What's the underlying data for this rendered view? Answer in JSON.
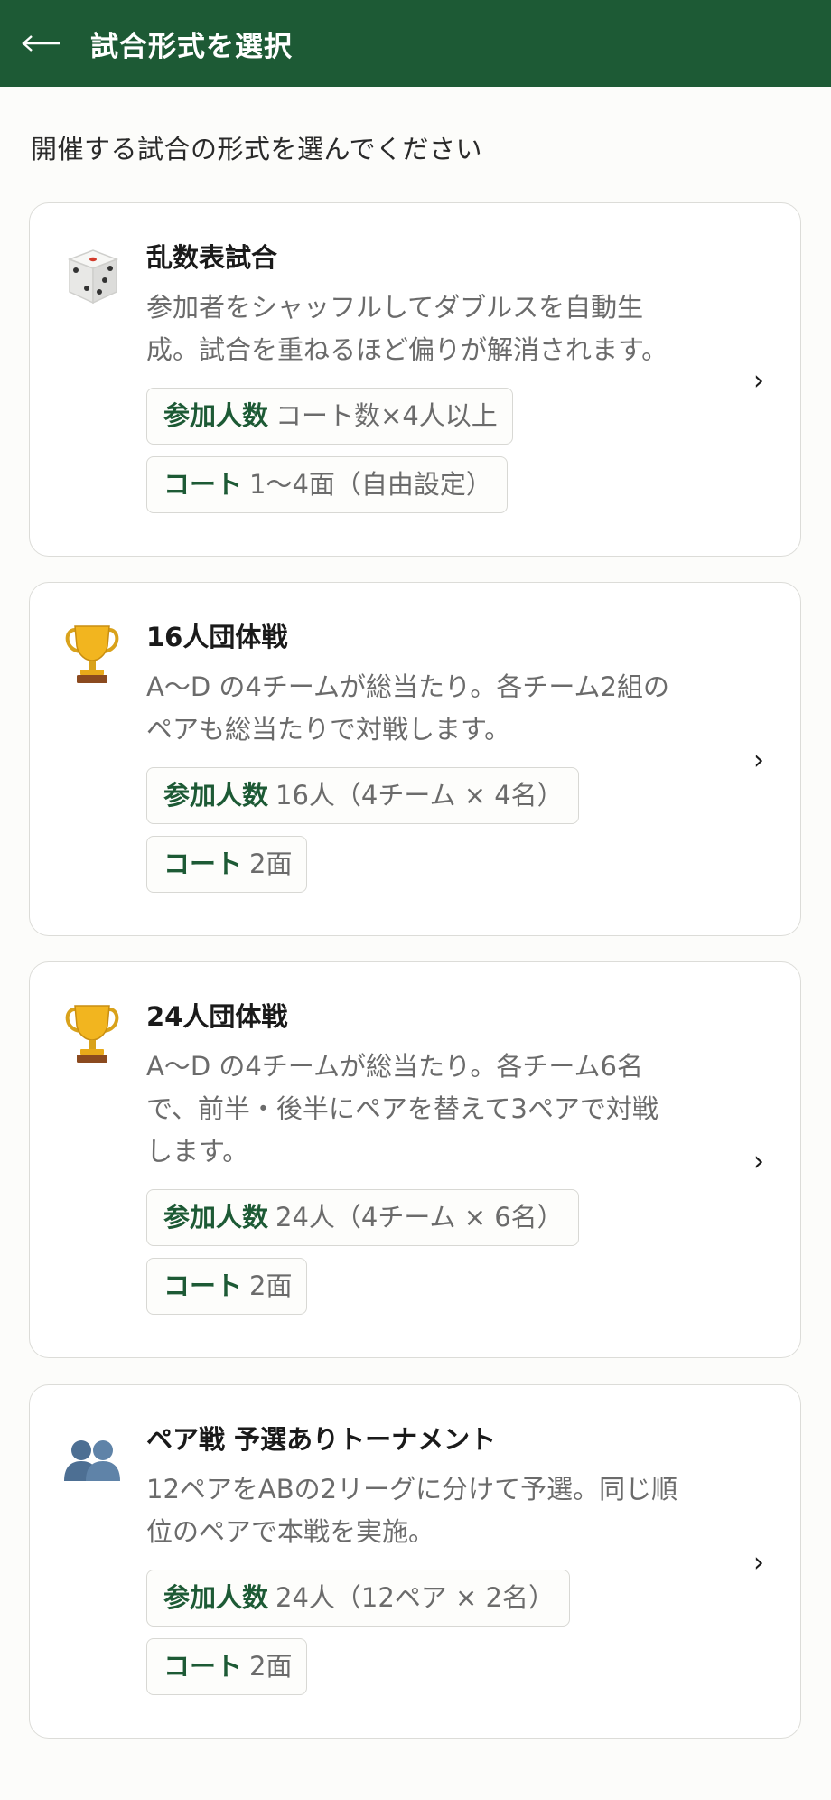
{
  "appbar": {
    "title": "試合形式を選択",
    "back_icon": "arrow-left-icon"
  },
  "intro": "開催する試合の形式を選んでください",
  "cards": [
    {
      "icon": "dice-icon",
      "title": "乱数表試合",
      "desc_lines": [
        "参加者をシャッフルしてダブルスを自動生",
        "成。試合を重ねるほど偏りが解消されます。"
      ],
      "players_key": "参加人数",
      "players_val": "コート数×4人以上",
      "courts_key": "コート",
      "courts_val": "1〜4面（自由設定）"
    },
    {
      "icon": "trophy-icon",
      "title": "16人団体戦",
      "desc_lines": [
        "A〜D の4チームが総当たり。各チーム2組の",
        "ペアも総当たりで対戦します。"
      ],
      "players_key": "参加人数",
      "players_val": "16人（4チーム × 4名）",
      "courts_key": "コート",
      "courts_val": "2面"
    },
    {
      "icon": "trophy-icon",
      "title": "24人団体戦",
      "desc_lines": [
        "A〜D の4チームが総当たり。各チーム6名",
        "で、前半・後半にペアを替えて3ペアで対戦",
        "します。"
      ],
      "players_key": "参加人数",
      "players_val": "24人（4チーム × 6名）",
      "courts_key": "コート",
      "courts_val": "2面"
    },
    {
      "icon": "two-people-icon",
      "title": "ペア戦 予選ありトーナメント",
      "desc_lines": [
        "12ペアをABの2リーグに分けて予選。同じ順",
        "位のペアで本戦を実施。"
      ],
      "players_key": "参加人数",
      "players_val": "24人（12ペア × 2名）",
      "courts_key": "コート",
      "courts_val": "2面"
    }
  ],
  "chevron": "›",
  "colors": {
    "appbar": "#1d5a35",
    "tag_key": "#1d5a35",
    "muted": "#6b6b6b"
  }
}
